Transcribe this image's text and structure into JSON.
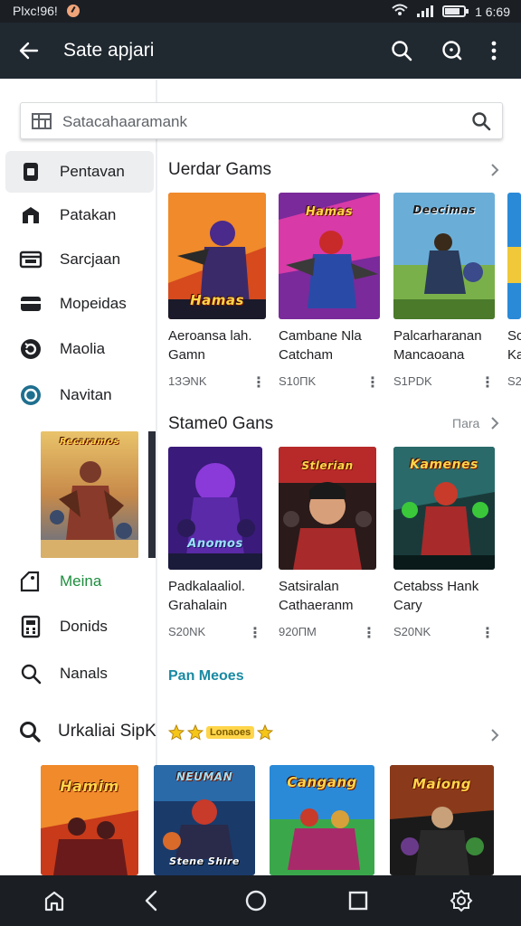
{
  "status_bar": {
    "time_left": "Plxc!96!",
    "time_right": "1 6:69"
  },
  "app_bar": {
    "title": "Sate apjari",
    "back_icon": "arrow-left-icon",
    "actions": [
      "search-icon",
      "help-icon",
      "more-vert-icon"
    ]
  },
  "search": {
    "placeholder": "Satacahaaramank"
  },
  "sidebar": {
    "items": [
      {
        "label": "Pentavan",
        "icon": "device-icon",
        "active": true
      },
      {
        "label": "Patakan",
        "icon": "store-icon",
        "active": false
      },
      {
        "label": "Sarcjaan",
        "icon": "inbox-icon",
        "active": false
      },
      {
        "label": "Mopeidas",
        "icon": "card-icon",
        "active": false
      },
      {
        "label": "Maolia",
        "icon": "refresh-icon",
        "active": false
      },
      {
        "label": "Navitan",
        "icon": "shield-icon",
        "active": false
      },
      {
        "label": "Meina",
        "icon": "tag-icon",
        "active": false,
        "highlight": true
      },
      {
        "label": "Donids",
        "icon": "calculator-icon",
        "active": false
      },
      {
        "label": "Nanals",
        "icon": "search-icon",
        "active": false
      }
    ],
    "bottom_heading": "Urkaliai SipK"
  },
  "section1": {
    "title": "Uerdar Gams",
    "cards": [
      {
        "name1": "Aeroansa lah.",
        "name2": "Gamn",
        "price": "1ЗЭNK",
        "art_title": "Hamas"
      },
      {
        "name1": "Cambane Nla",
        "name2": "Catcham",
        "price": "S10ПK",
        "art_title": "Hamas"
      },
      {
        "name1": "Palcarharanan",
        "name2": "Mancaoana",
        "price": "S1PDK",
        "art_title": "Deecimas"
      },
      {
        "name1": "Sc",
        "name2": "Ka",
        "price": "S2",
        "art_title": ""
      }
    ]
  },
  "section2": {
    "title": "Stame0 Gans",
    "more": "Пara",
    "cards": [
      {
        "name1": "Padkalaaliol.",
        "name2": "Grahalain",
        "price": "S20NK",
        "art_title": "Anomos"
      },
      {
        "name1": "Satsiralan",
        "name2": "Cathaeranm",
        "price": "920ПM",
        "art_title": "Stlerian"
      },
      {
        "name1": "Cetabss Hank",
        "name2": "Cary",
        "price": "S20NK",
        "art_title": "Kamenes"
      }
    ]
  },
  "link_text": "Pan Meoes",
  "badge": "Lonaoes",
  "bottom_cards": [
    {
      "art_title": "Hamim"
    },
    {
      "art_title": "Stene Shire"
    },
    {
      "art_title": "Cangang"
    },
    {
      "art_title": "Maiong"
    }
  ],
  "side_art_title": "Recaramos"
}
